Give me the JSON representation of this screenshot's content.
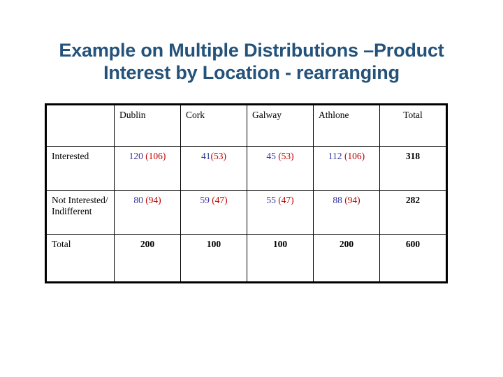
{
  "slide": {
    "title": "Example on Multiple Distributions –Product Interest by Location - rearranging",
    "title_color": "#24527A",
    "background_color": "#FFFFFF"
  },
  "colors": {
    "observed": "#333399",
    "expected": "#C00000",
    "total": "#000000",
    "border": "#000000"
  },
  "table": {
    "corner_label": "",
    "column_headers": [
      "Dublin",
      "Cork",
      "Galway",
      "Athlone",
      "Total"
    ],
    "rows": [
      {
        "label": "Interested",
        "cells": [
          {
            "observed": "120",
            "expected": "(106)",
            "separator": " "
          },
          {
            "observed": "41",
            "expected": "(53)",
            "separator": ""
          },
          {
            "observed": "45",
            "expected": "(53)",
            "separator": " "
          },
          {
            "observed": "112",
            "expected": "(106)",
            "separator": " "
          }
        ],
        "total": "318"
      },
      {
        "label": "Not Interested/Indifferent",
        "cells": [
          {
            "observed": "80",
            "expected": "(94)",
            "separator": " "
          },
          {
            "observed": "59",
            "expected": "(47)",
            "separator": " "
          },
          {
            "observed": "55",
            "expected": "(47)",
            "separator": " "
          },
          {
            "observed": "88",
            "expected": "(94)",
            "separator": " "
          }
        ],
        "total": "282"
      }
    ],
    "total_row": {
      "label": "Total",
      "cells": [
        "200",
        "100",
        "100",
        "200"
      ],
      "total": "600"
    }
  }
}
